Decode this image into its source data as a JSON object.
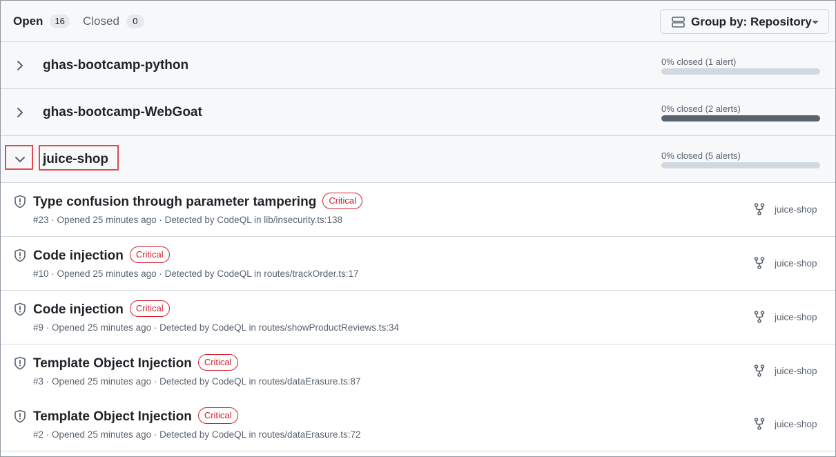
{
  "tabs": {
    "open": {
      "label": "Open",
      "count": "16"
    },
    "closed": {
      "label": "Closed",
      "count": "0"
    }
  },
  "group_by": {
    "label": "Group by: Repository",
    "icon": "rows-icon"
  },
  "colors": {
    "critical": "#cf222e",
    "progress_track": "#d1d9e0",
    "progress_track_hover": "#59636e",
    "highlight": "#e5484d"
  },
  "groups": [
    {
      "name": "ghas-bootcamp-python",
      "progress_text": "0% closed (1 alert)",
      "percent_closed": 0,
      "expanded": false
    },
    {
      "name": "ghas-bootcamp-WebGoat",
      "progress_text": "0% closed (2 alerts)",
      "percent_closed": 0,
      "expanded": false
    },
    {
      "name": "juice-shop",
      "progress_text": "0% closed (5 alerts)",
      "percent_closed": 0,
      "expanded": true
    }
  ],
  "alerts": [
    {
      "title": "Type confusion through parameter tampering",
      "severity": "Critical",
      "meta": "#23 · Opened 25 minutes ago · Detected by CodeQL in lib/insecurity.ts:138",
      "repo": "juice-shop"
    },
    {
      "title": "Code injection",
      "severity": "Critical",
      "meta": "#10 · Opened 25 minutes ago · Detected by CodeQL in routes/trackOrder.ts:17",
      "repo": "juice-shop"
    },
    {
      "title": "Code injection",
      "severity": "Critical",
      "meta": "#9 · Opened 25 minutes ago · Detected by CodeQL in routes/showProductReviews.ts:34",
      "repo": "juice-shop"
    },
    {
      "title": "Template Object Injection",
      "severity": "Critical",
      "meta": "#3 · Opened 25 minutes ago · Detected by CodeQL in routes/dataErasure.ts:87",
      "repo": "juice-shop"
    },
    {
      "title": "Template Object Injection",
      "severity": "Critical",
      "meta": "#2 · Opened 25 minutes ago · Detected by CodeQL in routes/dataErasure.ts:72",
      "repo": "juice-shop"
    }
  ]
}
